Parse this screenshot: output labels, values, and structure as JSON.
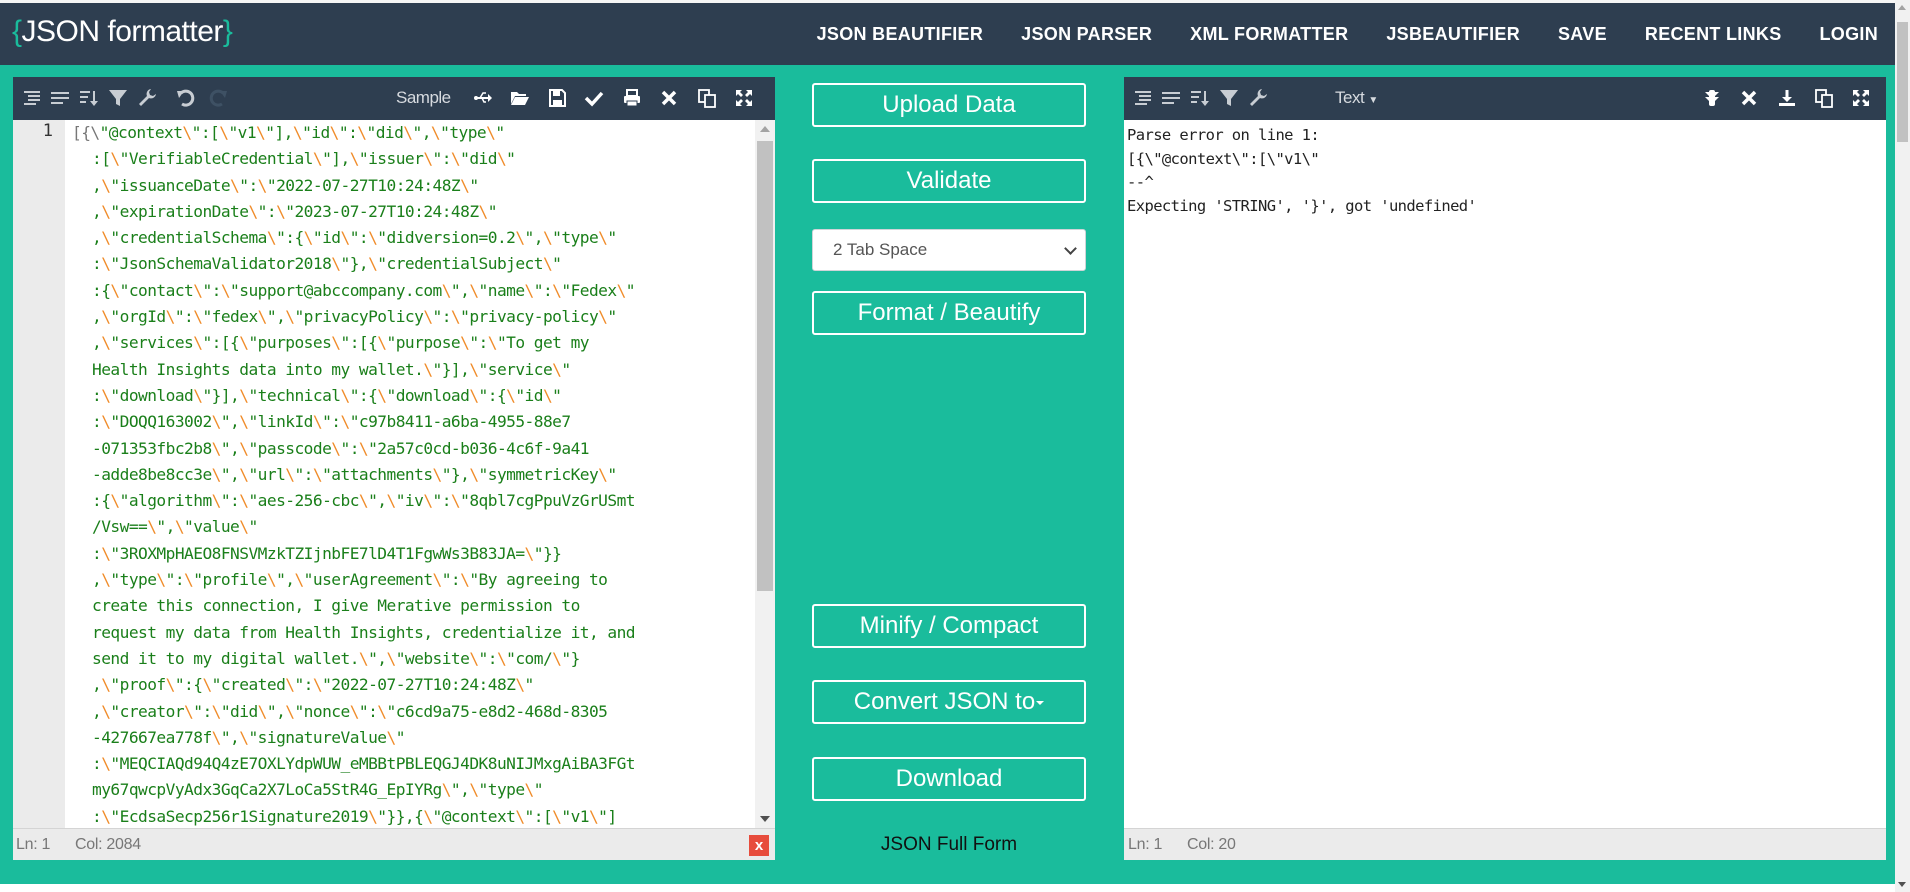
{
  "header": {
    "logo": {
      "open": "{",
      "text": "JSON formatter",
      "close": "}"
    },
    "nav": [
      "JSON BEAUTIFIER",
      "JSON PARSER",
      "XML FORMATTER",
      "JSBEAUTIFIER",
      "SAVE",
      "RECENT LINKS",
      "LOGIN"
    ]
  },
  "colors": {
    "header_bg": "#2e3e50",
    "accent": "#1abc9c",
    "string": "#1a7f1a",
    "escape": "#f08c2a",
    "error": "#e74c3c"
  },
  "left_panel": {
    "toolbar": {
      "icons_left": [
        "format-icon",
        "compact-icon",
        "sort-icon",
        "filter-icon",
        "repair-icon",
        "undo-icon",
        "redo-icon"
      ],
      "sample_label": "Sample",
      "icons_right": [
        "usb-icon",
        "folder-open-icon",
        "save-icon",
        "check-icon",
        "print-icon",
        "clear-icon",
        "copy-icon",
        "fullscreen-icon"
      ]
    },
    "line_number": "1",
    "code_lines": [
      "[{\\\"@context\\\":[\\\"v1\\\"],\\\"id\\\":\\\"did\\\",\\\"type\\\"",
      ":[\\\"VerifiableCredential\\\"],\\\"issuer\\\":\\\"did\\\"",
      ",\\\"issuanceDate\\\":\\\"2022-07-27T10:24:48Z\\\"",
      ",\\\"expirationDate\\\":\\\"2023-07-27T10:24:48Z\\\"",
      ",\\\"credentialSchema\\\":{\\\"id\\\":\\\"didversion=0.2\\\",\\\"type\\\"",
      ":\\\"JsonSchemaValidator2018\\\"},\\\"credentialSubject\\\"",
      ":{\\\"contact\\\":\\\"support@abccompany.com\\\",\\\"name\\\":\\\"Fedex\\\"",
      ",\\\"orgId\\\":\\\"fedex\\\",\\\"privacyPolicy\\\":\\\"privacy-policy\\\"",
      ",\\\"services\\\":[{\\\"purposes\\\":[{\\\"purpose\\\":\\\"To get my",
      "Health Insights data into my wallet.\\\"}],\\\"service\\\"",
      ":\\\"download\\\"}],\\\"technical\\\":{\\\"download\\\":{\\\"id\\\"",
      ":\\\"DOQQ163002\\\",\\\"linkId\\\":\\\"c97b8411-a6ba-4955-88e7",
      "-071353fbc2b8\\\",\\\"passcode\\\":\\\"2a57c0cd-b036-4c6f-9a41",
      "-adde8be8cc3e\\\",\\\"url\\\":\\\"attachments\\\"},\\\"symmetricKey\\\"",
      ":{\\\"algorithm\\\":\\\"aes-256-cbc\\\",\\\"iv\\\":\\\"8qbl7cgPpuVzGrUSmt",
      "/Vsw==\\\",\\\"value\\\"",
      ":\\\"3ROXMpHAEO8FNSVMzkTZIjnbFE7lD4T1FgwWs3B83JA=\\\"}}",
      ",\\\"type\\\":\\\"profile\\\",\\\"userAgreement\\\":\\\"By agreeing to",
      "create this connection, I give Merative permission to",
      "request my data from Health Insights, credentialize it, and",
      "send it to my digital wallet.\\\",\\\"website\\\":\\\"com/\\\"}",
      ",\\\"proof\\\":{\\\"created\\\":\\\"2022-07-27T10:24:48Z\\\"",
      ",\\\"creator\\\":\\\"did\\\",\\\"nonce\\\":\\\"c6cd9a75-e8d2-468d-8305",
      "-427667ea778f\\\",\\\"signatureValue\\\"",
      ":\\\"MEQCIAQd94Q4zE7OXLYdpWUW_eMBBtPBLEQGJ4DK8uNIJMxgAiBA3FGt",
      "my67qwcpVyAdx3GqCa2X7LoCa5StR4G_EpIYRg\\\",\\\"type\\\"",
      ":\\\"EcdsaSecp256r1Signature2019\\\"}},{\\\"@context\\\":[\\\"v1\\\"]"
    ],
    "status": {
      "ln": "Ln: 1",
      "col": "Col: 2084",
      "error_badge": "x"
    }
  },
  "middle": {
    "upload": "Upload Data",
    "validate": "Validate",
    "tab_select": "2 Tab Space",
    "format": "Format / Beautify",
    "minify": "Minify / Compact",
    "convert": "Convert JSON to",
    "download": "Download",
    "full_form": "JSON Full Form"
  },
  "right_panel": {
    "toolbar": {
      "icons_left": [
        "format-icon",
        "compact-icon",
        "sort-icon",
        "filter-icon",
        "repair-icon"
      ],
      "mode_label": "Text",
      "icons_right": [
        "traffic-icon",
        "clear-icon",
        "download-icon",
        "copy-icon",
        "fullscreen-icon"
      ]
    },
    "output": "Parse error on line 1:\n[{\\\"@context\\\":[\\\"v1\\\"\n--^\nExpecting 'STRING', '}', got 'undefined'",
    "status": {
      "ln": "Ln: 1",
      "col": "Col: 20"
    }
  }
}
